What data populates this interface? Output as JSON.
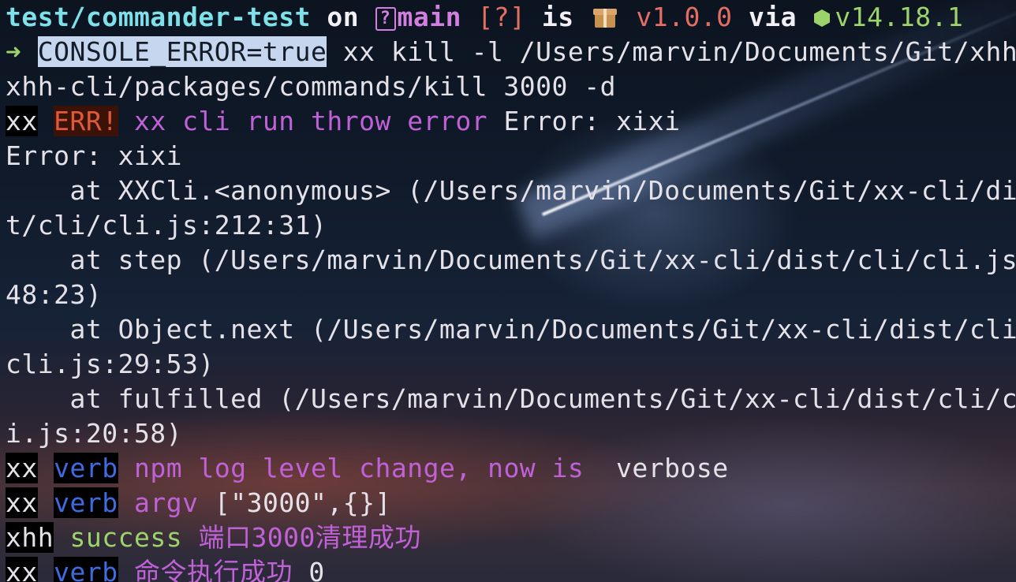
{
  "terminal": {
    "prompt": {
      "dir": "test/commander-test",
      "on": "on",
      "branch_icon": "?",
      "branch": "main",
      "status": "[?]",
      "is": "is",
      "pkg_icon": "package-icon",
      "pkg_version": "v1.0.0",
      "via": "via",
      "node_icon": "node-hexagon-icon",
      "node_version": "v14.18.1"
    },
    "command": {
      "arrow": "➜",
      "selected": "CONSOLE_ERROR=true",
      "rest": " xx kill -l /Users/marvin/Documents/Git/xhh/",
      "wrap": "xhh-cli/packages/commands/kill 3000 -d"
    },
    "error_line": {
      "prefix": "xx",
      "badge": "ERR!",
      "message": "xx cli run throw error",
      "tail": "Error: xixi"
    },
    "stack": [
      "Error: xixi",
      "    at XXCli.<anonymous> (/Users/marvin/Documents/Git/xx-cli/dis",
      "t/cli/cli.js:212:31)",
      "    at step (/Users/marvin/Documents/Git/xx-cli/dist/cli/cli.js:",
      "48:23)",
      "    at Object.next (/Users/marvin/Documents/Git/xx-cli/dist/cli/",
      "cli.js:29:53)",
      "    at fulfilled (/Users/marvin/Documents/Git/xx-cli/dist/cli/cl",
      "i.js:20:58)"
    ],
    "logs": [
      {
        "prefix": "xx",
        "level": "verb",
        "message": "npm log level change, now is ",
        "tail": "verbose",
        "level_color": "blue"
      },
      {
        "prefix": "xx",
        "level": "verb",
        "message": "argv",
        "tail": "[\"3000\",{}]",
        "level_color": "blue"
      },
      {
        "prefix": "xhh",
        "level": "success",
        "message": "端口3000清理成功",
        "tail": "",
        "level_color": "green"
      },
      {
        "prefix": "xx",
        "level": "verb",
        "message": "命令执行成功",
        "tail": "0",
        "level_color": "blue"
      }
    ]
  },
  "colors": {
    "dir": "#7ee0e8",
    "branch": "#d27fe0",
    "version": "#e56d62",
    "node": "#9cd36a",
    "magenta": "#c061d8",
    "verb_blue": "#3f6be0",
    "err_red": "#e05a3a",
    "selection": "#c6d6ee"
  }
}
